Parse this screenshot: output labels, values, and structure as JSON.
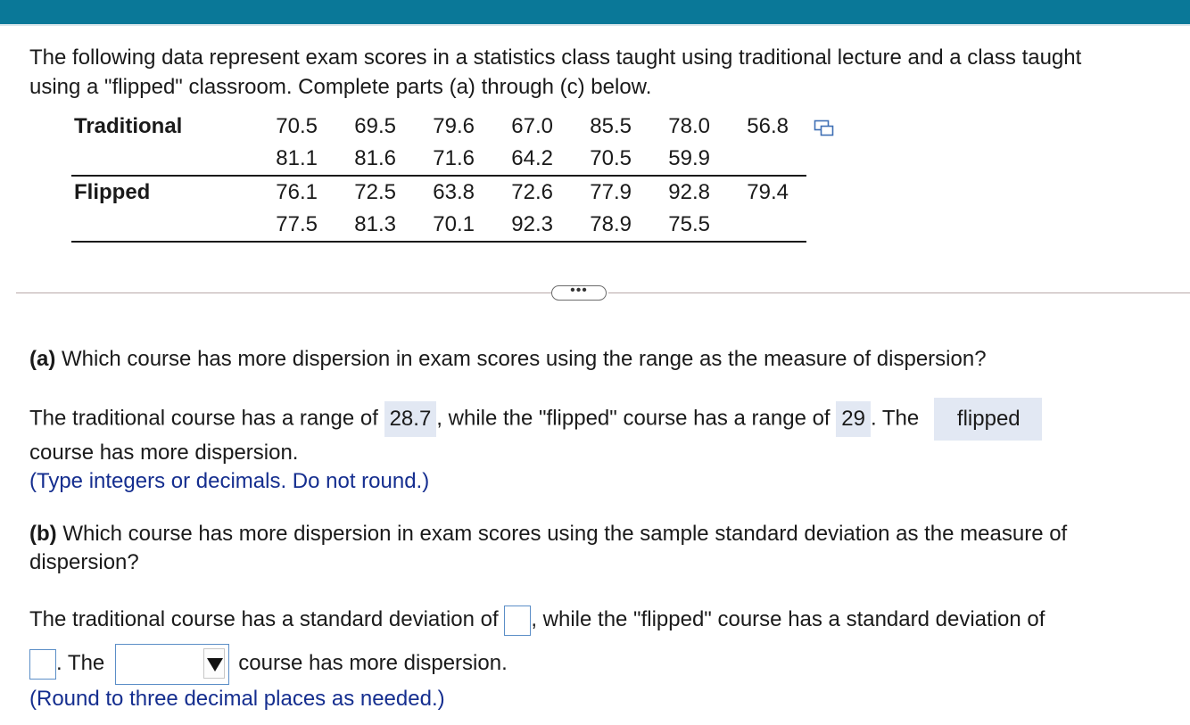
{
  "question": {
    "intro_lines": [
      "The following data represent exam scores in a statistics class taught using traditional lecture and a class taught",
      "using a \"flipped\" classroom. Complete parts (a) through (c) below."
    ]
  },
  "data_table": {
    "traditional": {
      "label": "Traditional",
      "row1": [
        "70.5",
        "69.5",
        "79.6",
        "67.0",
        "85.5",
        "78.0",
        "56.8"
      ],
      "row2": [
        "81.1",
        "81.6",
        "71.6",
        "64.2",
        "70.5",
        "59.9"
      ]
    },
    "flipped": {
      "label": "Flipped",
      "row1": [
        "76.1",
        "72.5",
        "63.8",
        "72.6",
        "77.9",
        "92.8",
        "79.4"
      ],
      "row2": [
        "77.5",
        "81.3",
        "70.1",
        "92.3",
        "78.9",
        "75.5"
      ]
    },
    "copy_icon": "copy-data-icon"
  },
  "separator": {
    "more_label": "•••"
  },
  "part_a": {
    "letter": "(a)",
    "question": " Which course has more dispersion in exam scores using the range as the measure of dispersion?",
    "t1": "The traditional course has a range of ",
    "traditional_range": "28.7",
    "t2": ", while the \"flipped\" course has a range of ",
    "flipped_range": "29",
    "t3": ". The ",
    "more_dispersion_course": "flipped",
    "t4": "course has more dispersion.",
    "hint": "(Type integers or decimals. Do not round.)"
  },
  "part_b": {
    "letter": "(b)",
    "question_line1": " Which course has more dispersion in exam scores using the sample standard deviation as the measure of",
    "question_line2": "dispersion?",
    "t1": "The traditional course has a standard deviation of ",
    "t2": ", while the \"flipped\" course has a standard deviation of",
    "t3": ". The",
    "t4": "course has more dispersion.",
    "traditional_sd_value": "",
    "flipped_sd_value": "",
    "course_select_value": "",
    "hint": "(Round to three decimal places as needed.)"
  }
}
